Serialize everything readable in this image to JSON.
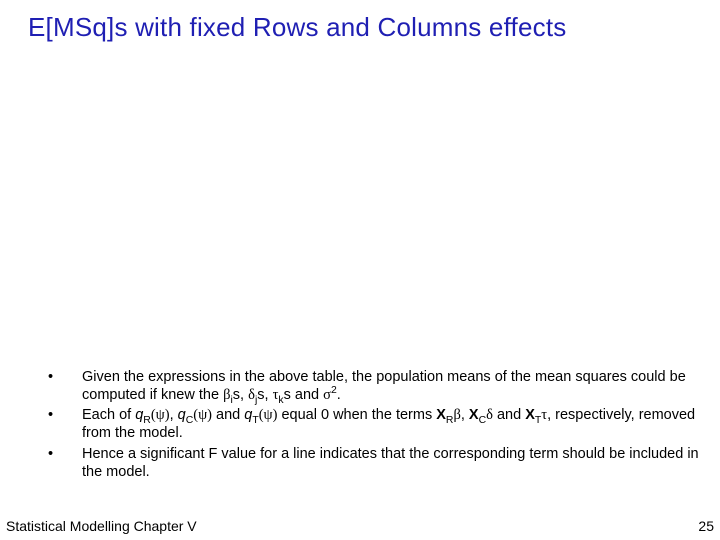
{
  "title": "E[MSq]s with fixed Rows and Columns effects",
  "bullets": [
    {
      "pre": "Given the expressions in the above table, the population means of the mean squares could be computed if knew the ",
      "sym1": "β",
      "sub1": "i",
      "mid1": "s, ",
      "sym2": "δ",
      "sub2": "j",
      "mid2": "s, ",
      "sym3": "τ",
      "sub3": "k",
      "mid3": "s and ",
      "sym4": "σ",
      "sup4": "2",
      "post": "."
    },
    {
      "pre": "Each of ",
      "q1": "q",
      "q1sub": "R",
      "q1arg": "(ψ)",
      "m1": ", ",
      "q2": "q",
      "q2sub": "C",
      "q2arg": "(ψ)",
      "m2": " and ",
      "q3": "q",
      "q3sub": "T",
      "q3arg": "(ψ)",
      "m3": " equal 0 when the terms ",
      "x1": "X",
      "x1sub": "R",
      "x1sym": "β",
      "m4": ", ",
      "x2": "X",
      "x2sub": "C",
      "x2sym": "δ",
      "m5": " and ",
      "x3": "X",
      "x3sub": "T",
      "x3sym": "τ",
      "post": ", respectively, removed from the model."
    },
    {
      "text": "Hence a significant F value for a line indicates that the corresponding term should be included in the model."
    }
  ],
  "footer_left": "Statistical Modelling   Chapter V",
  "footer_right": "25"
}
